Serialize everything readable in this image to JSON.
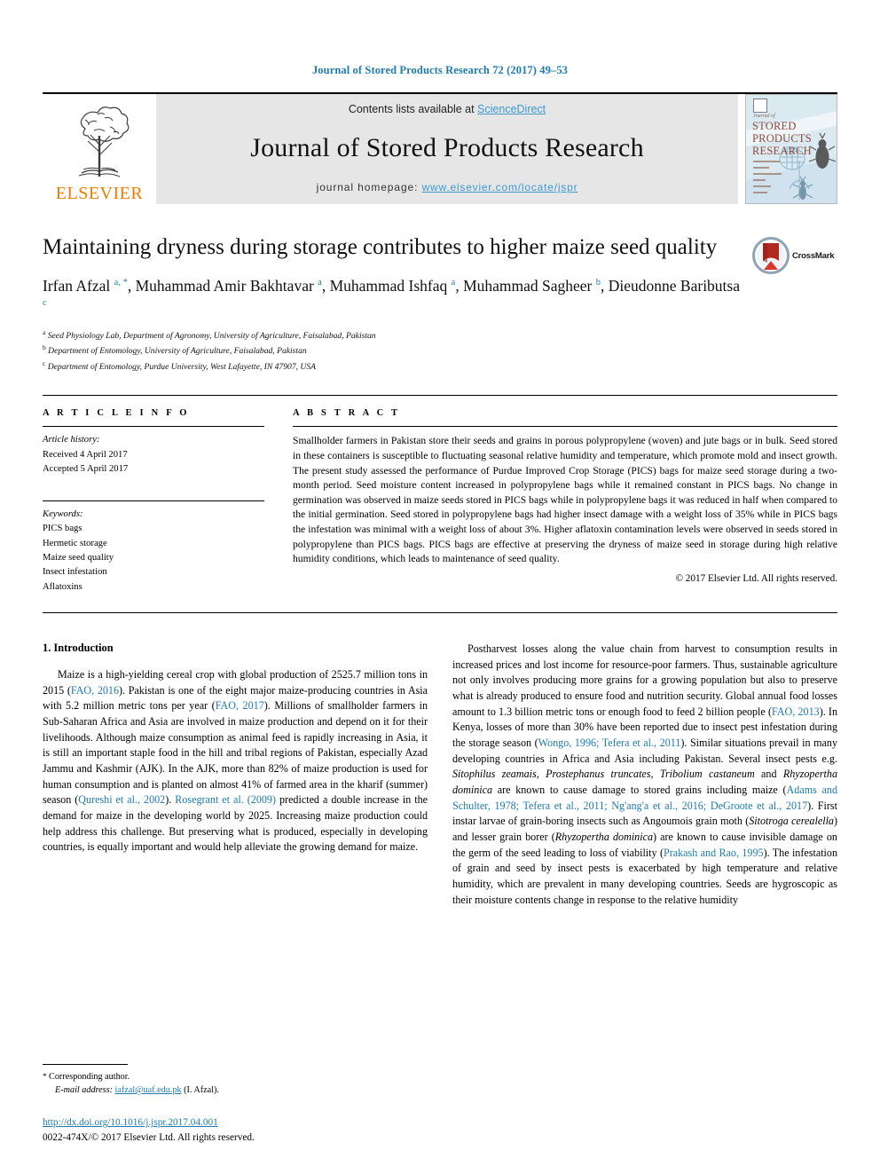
{
  "running_head": "Journal of Stored Products Research 72 (2017) 49–53",
  "masthead": {
    "publisher_name": "ELSEVIER",
    "contents_prefix": "Contents lists available at ",
    "sciencedirect": "ScienceDirect",
    "journal_name": "Journal of Stored Products Research",
    "homepage_prefix": "journal homepage: ",
    "homepage_url": "www.elsevier.com/locate/jspr",
    "cover": {
      "kicker": "Journal of",
      "line1": "STORED",
      "line2": "PRODUCTS",
      "line3": "RESEARCH"
    }
  },
  "article": {
    "title": "Maintaining dryness during storage contributes to higher maize seed quality",
    "crossmark_label": "CrossMark",
    "authors_html": "Irfan Afzal <sup>a, *</sup>, Muhammad Amir Bakhtavar <sup>a</sup>, Muhammad Ishfaq <sup>a</sup>, Muhammad Sagheer <sup>b</sup>, Dieudonne Baributsa <sup>c</sup>",
    "affiliations": [
      {
        "mark": "a",
        "text": "Seed Physiology Lab, Department of Agronomy, University of Agriculture, Faisalabad, Pakistan"
      },
      {
        "mark": "b",
        "text": "Department of Entomology, University of Agriculture, Faisalabad, Pakistan"
      },
      {
        "mark": "c",
        "text": "Department of Entomology, Purdue University, West Lafayette, IN 47907, USA"
      }
    ]
  },
  "article_info": {
    "heading": "A R T I C L E   I N F O",
    "history_label": "Article history:",
    "history": [
      "Received 4 April 2017",
      "Accepted 5 April 2017"
    ],
    "keywords_label": "Keywords:",
    "keywords": [
      "PICS bags",
      "Hermetic storage",
      "Maize seed quality",
      "Insect infestation",
      "Aflatoxins"
    ]
  },
  "abstract": {
    "heading": "A B S T R A C T",
    "text": "Smallholder farmers in Pakistan store their seeds and grains in porous polypropylene (woven) and jute bags or in bulk. Seed stored in these containers is susceptible to fluctuating seasonal relative humidity and temperature, which promote mold and insect growth. The present study assessed the performance of Purdue Improved Crop Storage (PICS) bags for maize seed storage during a two-month period. Seed moisture content increased in polypropylene bags while it remained constant in PICS bags. No change in germination was observed in maize seeds stored in PICS bags while in polypropylene bags it was reduced in half when compared to the initial germination. Seed stored in polypropylene bags had higher insect damage with a weight loss of 35% while in PICS bags the infestation was minimal with a weight loss of about 3%. Higher aflatoxin contamination levels were observed in seeds stored in polypropylene than PICS bags. PICS bags are effective at preserving the dryness of maize seed in storage during high relative humidity conditions, which leads to maintenance of seed quality.",
    "copyright": "© 2017 Elsevier Ltd. All rights reserved."
  },
  "body": {
    "section_number_title": "1.  Introduction",
    "left_paragraph_html": "Maize is a high-yielding cereal crop with global production of 2525.7 million tons in 2015 (<span class=\"ref\">FAO, 2016</span>). Pakistan is one of the eight major maize-producing countries in Asia with 5.2 million metric tons per year (<span class=\"ref\">FAO, 2017</span>). Millions of smallholder farmers in Sub-Saharan Africa and Asia are involved in maize production and depend on it for their livelihoods. Although maize consumption as animal feed is rapidly increasing in Asia, it is still an important staple food in the hill and tribal regions of Pakistan, especially Azad Jammu and Kashmir (AJK). In the AJK, more than 82% of maize production is used for human consumption and is planted on almost 41% of farmed area in the kharif (summer) season (<span class=\"ref\">Qureshi et al., 2002</span>). <span class=\"ref\">Rosegrant et al. (2009)</span> predicted a double increase in the demand for maize in the developing world by 2025. Increasing maize production could help address this challenge. But preserving what is produced, especially in developing countries, is equally important and would help alleviate the growing demand for maize.",
    "right_paragraph_html": "Postharvest losses along the value chain from harvest to consumption results in increased prices and lost income for resource-poor farmers. Thus, sustainable agriculture not only involves producing more grains for a growing population but also to preserve what is already produced to ensure food and nutrition security. Global annual food losses amount to 1.3 billion metric tons or enough food to feed 2 billion people (<span class=\"ref\">FAO, 2013</span>). In Kenya, losses of more than 30% have been reported due to insect pest infestation during the storage season (<span class=\"ref\">Wongo, 1996; Tefera et al., 2011</span>). Similar situations prevail in many developing countries in Africa and Asia including Pakistan. Several insect pests e.g. <span class=\"sci\">Sitophilus zeamais</span>, <span class=\"sci\">Prostephanus truncates</span>, <span class=\"sci\">Tribolium castaneum</span> and <span class=\"sci\">Rhyzopertha dominica</span> are known to cause damage to stored grains including maize (<span class=\"ref\">Adams and Schulter, 1978; Tefera et al., 2011; Ng'ang'a et al., 2016; DeGroote et al., 2017</span>). First instar larvae of grain-boring insects such as Angoumois grain moth (<span class=\"sci\">Sitotroga cerealella</span>) and lesser grain borer (<span class=\"sci\">Rhyzopertha dominica</span>) are known to cause invisible damage on the germ of the seed leading to loss of viability (<span class=\"ref\">Prakash and Rao, 1995</span>). The infestation of grain and seed by insect pests is exacerbated by high temperature and relative humidity, which are prevalent in many developing countries. Seeds are hygroscopic as their moisture contents change in response to the relative humidity"
  },
  "footnotes": {
    "corresponding_star": "*",
    "corresponding_label": "Corresponding author.",
    "email_label": "E-mail address:",
    "email": "iafzal@uaf.edu.pk",
    "email_suffix": "(I. Afzal).",
    "doi": "http://dx.doi.org/10.1016/j.jspr.2017.04.001",
    "issn_line": "0022-474X/© 2017 Elsevier Ltd. All rights reserved."
  },
  "colors": {
    "link": "#1e7bb0",
    "sciencedirect": "#3d9ad1",
    "elsevier_orange": "#f07c00",
    "masthead_bg": "#e6e6e6"
  }
}
